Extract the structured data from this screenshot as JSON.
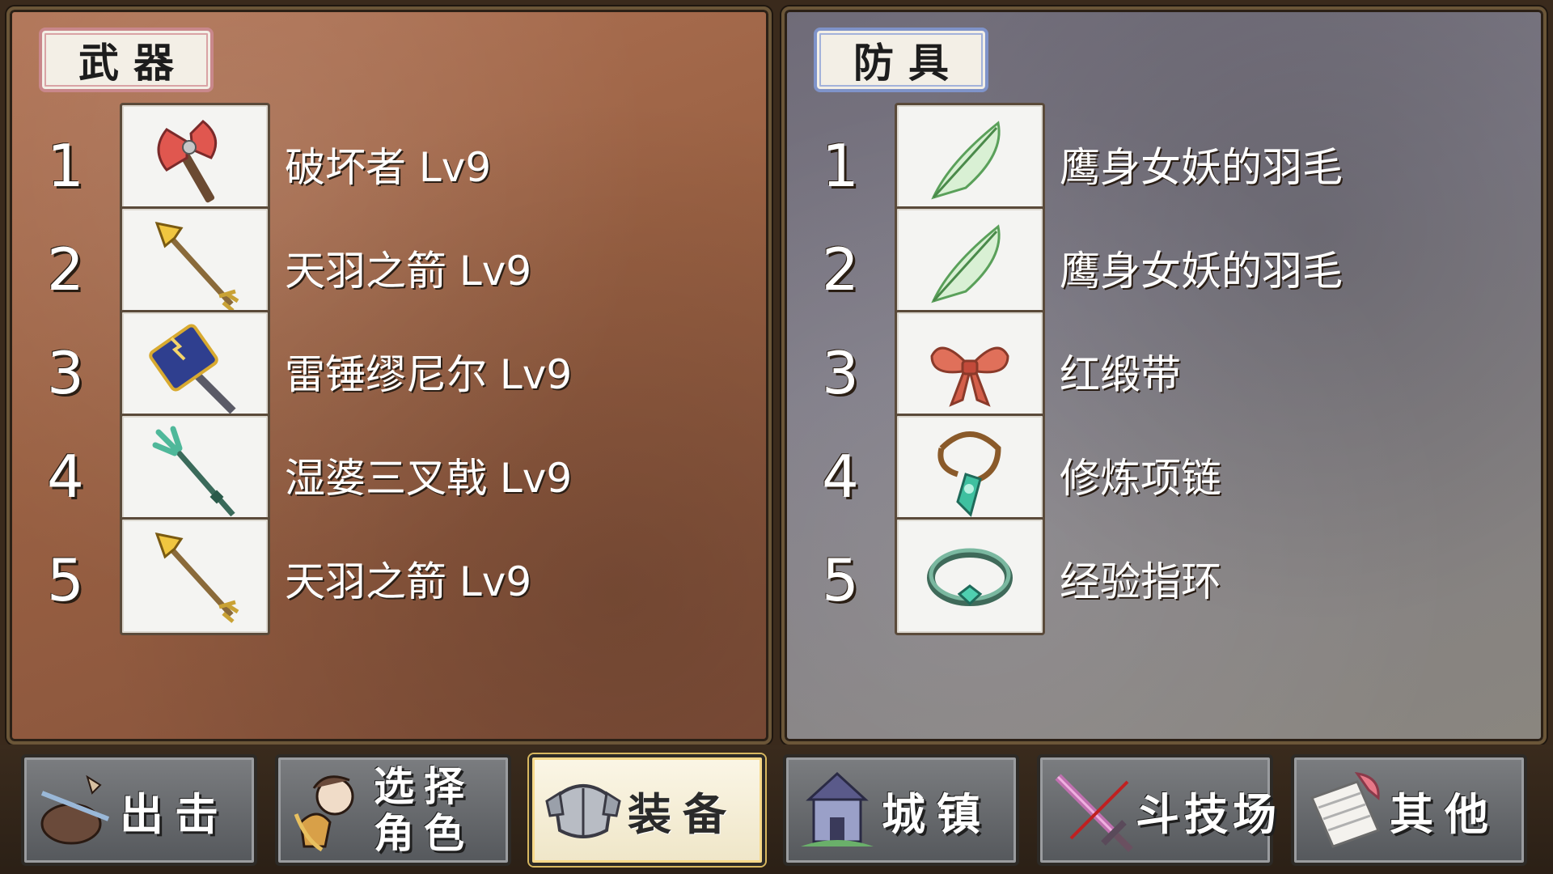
{
  "weapons_panel": {
    "title": "武器",
    "items": [
      {
        "num": "1",
        "name": "破坏者 Lv9",
        "icon": "red-axe-icon"
      },
      {
        "num": "2",
        "name": "天羽之箭 Lv9",
        "icon": "golden-arrow-icon"
      },
      {
        "num": "3",
        "name": "雷锤缪尼尔 Lv9",
        "icon": "thunder-hammer-icon"
      },
      {
        "num": "4",
        "name": "湿婆三叉戟 Lv9",
        "icon": "trident-icon"
      },
      {
        "num": "5",
        "name": "天羽之箭 Lv9",
        "icon": "golden-arrow-icon"
      }
    ]
  },
  "armor_panel": {
    "title": "防具",
    "items": [
      {
        "num": "1",
        "name": "鹰身女妖的羽毛",
        "icon": "feather-icon"
      },
      {
        "num": "2",
        "name": "鹰身女妖的羽毛",
        "icon": "feather-icon"
      },
      {
        "num": "3",
        "name": "红缎带",
        "icon": "red-ribbon-icon"
      },
      {
        "num": "4",
        "name": "修炼项链",
        "icon": "necklace-icon"
      },
      {
        "num": "5",
        "name": "经验指环",
        "icon": "ring-icon"
      }
    ]
  },
  "menu": {
    "sortie": "出击",
    "select_line1": "选择",
    "select_line2": "角色",
    "equip": "装备",
    "town": "城镇",
    "arena": "斗技场",
    "other": "其他"
  },
  "colors": {
    "weapons_accent": "#c9878b",
    "armor_accent": "#7f93c9",
    "active_button": "#fbf6e6"
  }
}
